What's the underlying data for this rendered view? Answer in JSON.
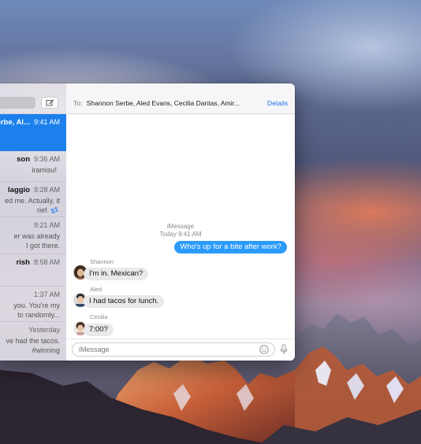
{
  "sidebar": {
    "conversations": [
      {
        "name": "erbe, Al...",
        "time": "9:41 AM",
        "preview": [],
        "selected": true
      },
      {
        "name": "son",
        "time": "9:36 AM",
        "preview": [
          "iramisu!"
        ]
      },
      {
        "name": "laggio",
        "time": "9:28 AM",
        "preview": [
          "ed me. Actually, it",
          "rief."
        ]
      },
      {
        "name": "",
        "time": "9:21 AM",
        "preview": [
          "er was already",
          "I got there."
        ]
      },
      {
        "name": "rish",
        "time": "8:58 AM",
        "preview": []
      },
      {
        "name": "",
        "time": "1:37 AM",
        "preview": [
          "you. You're my",
          "to randomly..."
        ]
      },
      {
        "name": "",
        "time": "Yesterday",
        "preview": [
          "ve had the tacos.",
          "#winning"
        ]
      }
    ]
  },
  "chat": {
    "to_label": "To:",
    "recipients": "Shannon Serbe, Aled Evans, Cecilia Dantas, Amir...",
    "details_label": "Details",
    "service": "iMessage",
    "timestamp": "Today 9:41 AM",
    "messages": [
      {
        "from": "me",
        "text": "Who's up for a bite after work?"
      },
      {
        "from": "Shannon",
        "text": "I'm in. Mexican?"
      },
      {
        "from": "Aled",
        "text": "I had tacos for lunch."
      },
      {
        "from": "Cecilia",
        "text": "7:00?"
      }
    ],
    "input_placeholder": "iMessage"
  },
  "colors": {
    "accent": "#1c80ec",
    "outgoing_bubble": "#2a9bfb",
    "incoming_bubble": "#e9e9eb"
  },
  "icons": [
    "compose-icon",
    "emoji-icon",
    "microphone-icon",
    "typing-indicator-icon"
  ]
}
